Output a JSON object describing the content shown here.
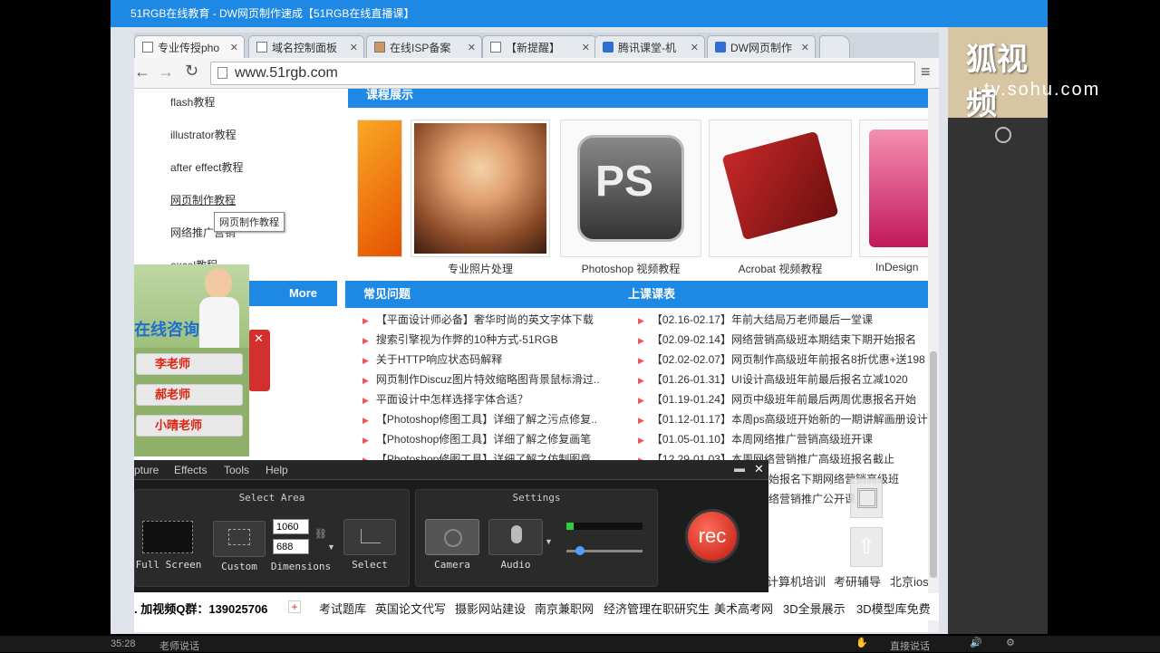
{
  "window_title": "51RGB在线教育 - DW网页制作速成【51RGB在线直播课】",
  "tabs": [
    {
      "label": "专业传授pho",
      "icon": "page-icon",
      "active": true
    },
    {
      "label": "域名控制面板",
      "icon": "page-icon"
    },
    {
      "label": "在线ISP备案",
      "icon": "image-icon"
    },
    {
      "label": "【新提醒】",
      "icon": "page-icon"
    },
    {
      "label": "腾讯课堂-机",
      "icon": "tencent-icon"
    },
    {
      "label": "DW网页制作",
      "icon": "tencent-icon"
    }
  ],
  "url": "www.51rgb.com",
  "sidebar": {
    "items": [
      "flash教程",
      "illustrator教程",
      "after effect教程",
      "网页制作教程",
      "网络推广营销",
      "excel教程"
    ],
    "tooltip": "网页制作教程",
    "more": "More"
  },
  "courses": {
    "header": "课程展示",
    "items": [
      "专业照片处理",
      "Photoshop 视频教程",
      "Acrobat 视频教程",
      "InDesign"
    ]
  },
  "faq": {
    "header": "常见问题",
    "items": [
      "【平面设计师必备】奢华时尚的英文字体下载",
      "搜索引擎视为作弊的10种方式-51RGB",
      "关于HTTP响应状态码解释",
      "网页制作Discuz图片特效缩略图背景鼠标滑过..",
      "平面设计中怎样选择字体合适？",
      "【Photoshop修图工具】详细了解之污点修复..",
      "【Photoshop修图工具】详细了解之修复画笔",
      "【Photoshop修图工具】详细了解之仿制图章"
    ]
  },
  "schedule": {
    "header": "上课课表",
    "items": [
      "【02.16-02.17】年前大结局万老师最后一堂课",
      "【02.09-02.14】网络营销高级班本期结束下期开始报名",
      "【02.02-02.07】网页制作高级班年前报名8折优惠+送198",
      "【01.26-01.31】UI设计高级班年前最后报名立减1020",
      "【01.19-01.24】网页中级班年前最后两周优惠报名开始",
      "【01.12-01.17】本周ps高级班开始新的一期讲解画册设计",
      "【01.05-01.10】本周网络推广营销高级班开课",
      "【12.29-01.03】本周网络营销推广高级班报名截止",
      "始报名下期网络营销高级班",
      "络营销推广公开课"
    ]
  },
  "consult": {
    "title": "在线咨询",
    "teachers": [
      "李老师",
      "郝老师",
      "小晴老师"
    ]
  },
  "recorder": {
    "menu": [
      "pture",
      "Effects",
      "Tools",
      "Help"
    ],
    "select_area": "Select Area",
    "settings": "Settings",
    "full_screen": "Full Screen",
    "custom": "Custom",
    "dimensions": "Dimensions",
    "select": "Select",
    "width": "1060",
    "height": "688",
    "camera": "Camera",
    "audio": "Audio",
    "rec": "rec"
  },
  "misc_links": [
    "计算机培训",
    "考研辅导",
    "北京ios"
  ],
  "bottom_links": {
    "qq": ". 加视频Q群：139025706",
    "items": [
      "考试题库",
      "英国论文代写",
      "摄影网站建设",
      "南京兼职网",
      "经济管理在职研究生",
      "美术高考网",
      "3D全景展示",
      "3D模型库免费"
    ]
  },
  "status": {
    "time": "35:28",
    "left": "老师说话",
    "right": "直接说话"
  },
  "sohu": {
    "logo": "狐视频",
    "domain": "tv.sohu.com"
  }
}
